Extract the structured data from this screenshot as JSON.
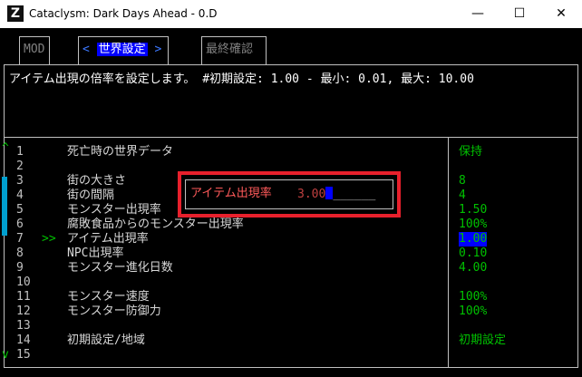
{
  "window": {
    "title": "Cataclysm: Dark Days Ahead - 0.D",
    "icon_letter": "Z",
    "minimize_glyph": "—",
    "maximize_glyph": "☐",
    "close_glyph": "✕"
  },
  "tabs": [
    {
      "label": "MOD"
    },
    {
      "label": "世界設定",
      "prefix": "<",
      "suffix": ">"
    },
    {
      "label": "最終確認"
    }
  ],
  "description": "アイテム出現の倍率を設定します。 #初期設定: 1.00 - 最小: 0.01, 最大: 10.00",
  "scroll_up_glyph": "^",
  "scroll_down_glyph": "v",
  "cursor_marker": ">>",
  "rows": [
    {
      "num": "1",
      "label": "死亡時の世界データ",
      "value": "保持"
    },
    {
      "num": "2",
      "label": "",
      "value": ""
    },
    {
      "num": "3",
      "label": "街の大きさ",
      "value": "8"
    },
    {
      "num": "4",
      "label": "街の間隔",
      "value": "4"
    },
    {
      "num": "5",
      "label": "モンスター出現率",
      "value": "1.50"
    },
    {
      "num": "6",
      "label": "腐敗食品からのモンスター出現率",
      "value": "100%"
    },
    {
      "num": "7",
      "label": "アイテム出現率",
      "value": "1.00"
    },
    {
      "num": "8",
      "label": "NPC出現率",
      "value": "0.10"
    },
    {
      "num": "9",
      "label": "モンスター進化日数",
      "value": "4.00"
    },
    {
      "num": "10",
      "label": "",
      "value": ""
    },
    {
      "num": "11",
      "label": "モンスター速度",
      "value": "100%"
    },
    {
      "num": "12",
      "label": "モンスター防御力",
      "value": "100%"
    },
    {
      "num": "13",
      "label": "",
      "value": ""
    },
    {
      "num": "14",
      "label": "初期設定/地域",
      "value": "初期設定"
    },
    {
      "num": "15",
      "label": "",
      "value": ""
    }
  ],
  "popup": {
    "label": "アイテム出現率",
    "value": "3.00",
    "blank": "______"
  },
  "colors": {
    "accent_blue": "#0000ff",
    "value_green": "#00c000",
    "highlight_red": "#e8202c",
    "scroll_cyan": "#00a0d0"
  }
}
